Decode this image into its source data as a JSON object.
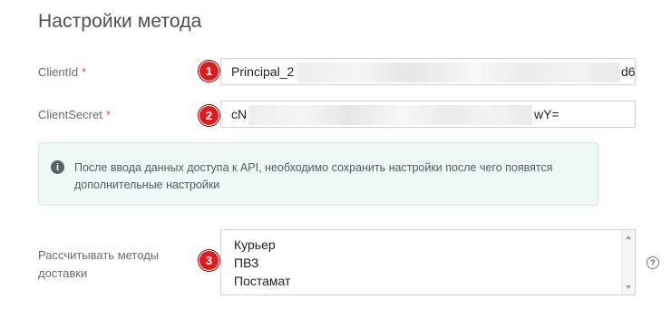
{
  "page": {
    "title": "Настройки метода"
  },
  "client_id": {
    "label": "ClientId",
    "required_mark": "*",
    "value_start": "Principal_2",
    "value_end": "d6",
    "badge": "1"
  },
  "client_secret": {
    "label": "ClientSecret",
    "required_mark": "*",
    "value_start": "cN",
    "value_end": "wY=",
    "badge": "2"
  },
  "info": {
    "icon": "info-icon",
    "text": "После ввода данных доступа к API, необходимо сохранить настройки после чего появятся дополнительные настройки"
  },
  "delivery_methods": {
    "label": "Рассчитывать методы доставки",
    "badge": "3",
    "options": [
      "Курьер",
      "ПВЗ",
      "Постамат"
    ],
    "help_icon": "question-circle-icon",
    "help_glyph": "?"
  },
  "colors": {
    "badge": "#e01b1b",
    "required": "#e0534a",
    "info_bg": "#eef6f6"
  }
}
